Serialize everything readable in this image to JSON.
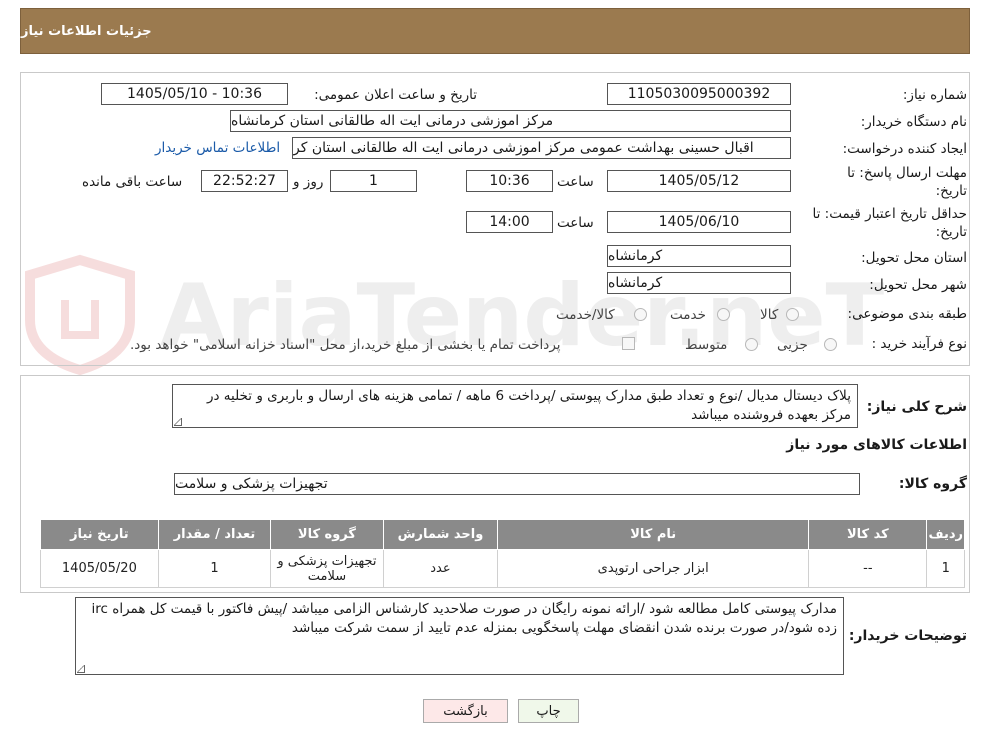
{
  "header": {
    "title": "جزئیات اطلاعات نیاز"
  },
  "watermark": {
    "text": "AriaTender.neT"
  },
  "form": {
    "need_number_label": "شماره نیاز:",
    "need_number": "1105030095000392",
    "announce_label": "تاریخ و ساعت اعلان عمومی:",
    "announce_value": "1405/05/10 - 10:36",
    "buyer_label": "نام دستگاه خریدار:",
    "buyer_value": "مرکز اموزشی درمانی ایت اله طالقانی استان کرمانشاه",
    "creator_label": "ایجاد کننده درخواست:",
    "creator_value": "اقبال حسینی بهداشت عمومی مرکز اموزشی درمانی ایت اله طالقانی استان کر",
    "contact_link": "اطلاعات تماس خریدار",
    "deadline_label_1": "مهلت ارسال پاسخ: تا",
    "deadline_label_2": "تاریخ:",
    "deadline_date": "1405/05/12",
    "time_label": "ساعت",
    "deadline_time": "10:36",
    "days_value": "1",
    "days_label": "روز و",
    "remaining_time": "22:52:27",
    "remaining_label": "ساعت باقی مانده",
    "validity_label_1": "حداقل تاریخ اعتبار قیمت: تا",
    "validity_label_2": "تاریخ:",
    "validity_date": "1405/06/10",
    "validity_time_label": "ساعت",
    "validity_time": "14:00",
    "province_label": "استان محل تحویل:",
    "province_value": "کرمانشاه",
    "city_label": "شهر محل تحویل:",
    "city_value": "کرمانشاه",
    "category_label": "طبقه بندی موضوعی:",
    "category_options": [
      "کالا",
      "خدمت",
      "کالا/خدمت"
    ],
    "process_label": "نوع فرآیند خرید :",
    "process_options": [
      "جزیی",
      "متوسط"
    ],
    "payment_note": "پرداخت تمام یا بخشی از مبلغ خرید،از محل \"اسناد خزانه اسلامی\" خواهد بود."
  },
  "summary": {
    "label": "شرح کلی نیاز:",
    "text": "پلاک دیستال مدیال  /نوع و تعداد طبق مدارک پیوستی /پرداخت 6 ماهه / تمامی هزینه های ارسال و باربری و تخلیه در مرکز بعهده فروشنده میباشد"
  },
  "goods": {
    "section_title": "اطلاعات کالاهای مورد نیاز",
    "group_label": "گروه کالا:",
    "group_value": "تجهیزات پزشکی و سلامت"
  },
  "table": {
    "headers": [
      "ردیف",
      "کد کالا",
      "نام کالا",
      "واحد شمارش",
      "گروه کالا",
      "تعداد / مقدار",
      "تاریخ نیاز"
    ],
    "rows": [
      [
        "1",
        "--",
        "ابزار جراحی ارتوپدی",
        "عدد",
        "تجهیزات پزشکی و سلامت",
        "1",
        "1405/05/20"
      ]
    ]
  },
  "buyer_notes": {
    "label": "توضیحات خریدار:",
    "text": "مدارک پیوستی کامل مطالعه شود /ارائه نمونه رایگان در صورت صلاحدید کارشناس الزامی میباشد /پیش فاکتور با قیمت کل همراه irc  زده شود/در صورت برنده شدن انقضای مهلت پاسخگویی بمنزله عدم تایید از سمت شرکت میباشد"
  },
  "buttons": {
    "print": "چاپ",
    "back": "بازگشت"
  },
  "colors": {
    "header": "#9b7a4f",
    "table_header": "#8a8a8a",
    "link": "#1a5aa8",
    "back_button": "#fde8e8"
  }
}
